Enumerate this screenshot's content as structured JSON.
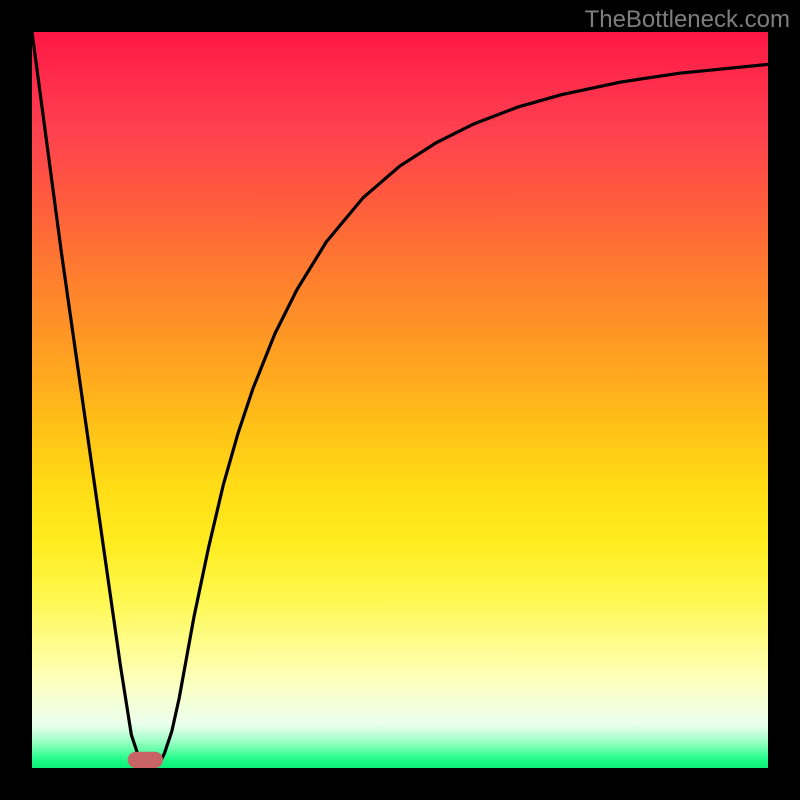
{
  "watermark": "TheBottleneck.com",
  "chart_data": {
    "type": "line",
    "title": "",
    "xlabel": "",
    "ylabel": "",
    "xlim": [
      0,
      100
    ],
    "ylim": [
      0,
      100
    ],
    "grid": false,
    "legend": false,
    "background_gradient": [
      "#ff1744",
      "#ff7a30",
      "#ffdd16",
      "#fffc88",
      "#0cef7a"
    ],
    "series": [
      {
        "name": "bottleneck-curve",
        "x": [
          0,
          2,
          4,
          6,
          8,
          10,
          12,
          13.5,
          15,
          16.5,
          17.5,
          18,
          19,
          20,
          21,
          22,
          24,
          26,
          28,
          30,
          33,
          36,
          40,
          45,
          50,
          55,
          60,
          66,
          72,
          80,
          88,
          95,
          100
        ],
        "y": [
          100,
          85,
          70,
          56,
          42,
          28,
          14,
          4.5,
          0,
          0,
          1,
          2,
          5,
          9.5,
          15,
          20.5,
          30,
          38.5,
          45.5,
          51.5,
          59,
          65,
          71.5,
          77.5,
          81.8,
          85,
          87.5,
          89.8,
          91.5,
          93.2,
          94.4,
          95.1,
          95.6
        ]
      }
    ],
    "marker": {
      "name": "optimal-zone",
      "shape": "rounded-rect",
      "color": "#c86466",
      "x_center": 15.4,
      "y": 0,
      "width_x": 4.8,
      "height_y": 2.2
    }
  }
}
